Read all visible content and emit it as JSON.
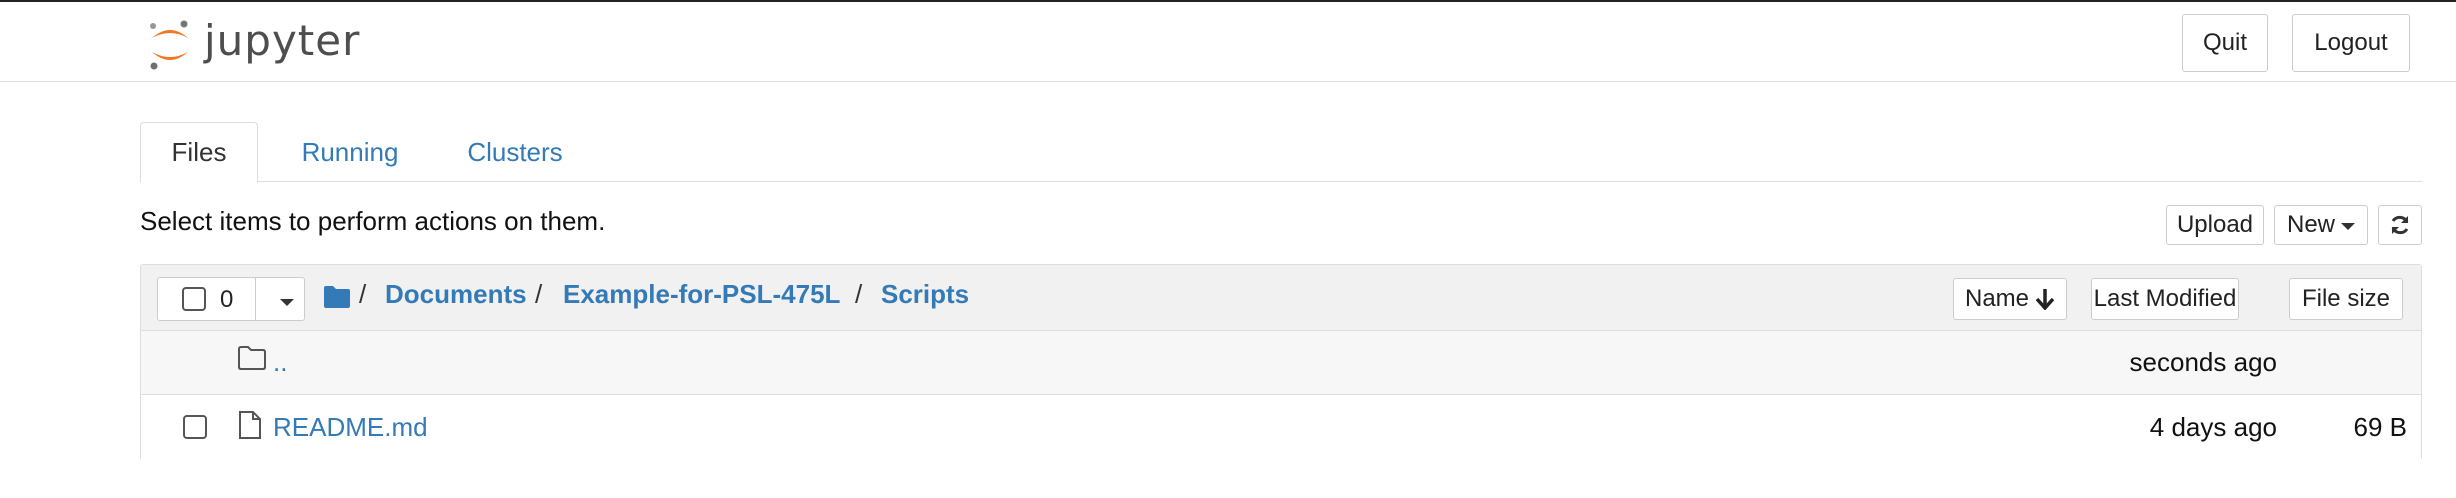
{
  "header": {
    "logo_text": "jupyter",
    "quit_label": "Quit",
    "logout_label": "Logout"
  },
  "tabs": [
    {
      "label": "Files",
      "active": true
    },
    {
      "label": "Running",
      "active": false
    },
    {
      "label": "Clusters",
      "active": false
    }
  ],
  "toolbar": {
    "info_text": "Select items to perform actions on them.",
    "upload_label": "Upload",
    "new_label": "New",
    "refresh_icon": "refresh-icon"
  },
  "list_header": {
    "selected_count": "0",
    "breadcrumb": [
      {
        "label": "/"
      },
      {
        "label": "Documents"
      },
      {
        "label": "/"
      },
      {
        "label": "Example-for-PSL-475L"
      },
      {
        "label": "/"
      },
      {
        "label": "Scripts"
      }
    ],
    "sort_name_label": "Name",
    "sort_modified_label": "Last Modified",
    "sort_size_label": "File size"
  },
  "files": [
    {
      "name": "..",
      "type": "folder",
      "modified": "seconds ago",
      "size": ""
    },
    {
      "name": "README.md",
      "type": "file",
      "modified": "4 days ago",
      "size": "69 B"
    }
  ],
  "colors": {
    "link": "#337ab7",
    "logo_orange": "#f37726"
  }
}
